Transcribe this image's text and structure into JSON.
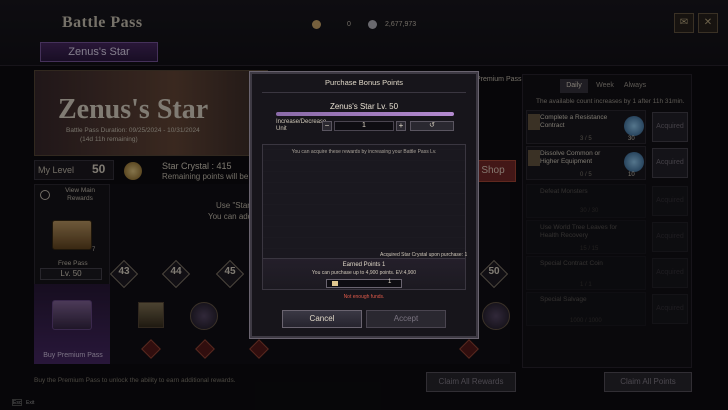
{
  "header": {
    "title": "Battle Pass",
    "tab": "Zenus's Star",
    "currency1": "0",
    "currency2": "2,677,973"
  },
  "banner": {
    "title": "Zenus's Star",
    "duration": "Battle Pass Duration: 09/25/2024 - 10/31/2024",
    "remaining": "(14d 11h remaining)",
    "premium_tag": "Premium Pass"
  },
  "level": {
    "label": "My Level",
    "value": "50"
  },
  "crystal": {
    "label": "Star Crystal : 415",
    "remaining": "Remaining points will be au"
  },
  "shop_label": "Shop",
  "left": {
    "view_main": "View Main Rewards",
    "free_pass": "Free Pass",
    "free_level": "Lv. 50",
    "buy_premium": "Buy Premium Pass",
    "chest_count": "7"
  },
  "track": {
    "use_label": "Use \"Star",
    "can_add": "You can add",
    "levels": [
      "43",
      "44",
      "45",
      "50"
    ]
  },
  "hint": "Buy the Premium Pass to unlock the ability to earn additional rewards.",
  "claim_all": "Claim All Rewards",
  "claim_all_points": "Claim All Points",
  "right": {
    "tabs": [
      "Daily",
      "Week",
      "Always"
    ],
    "note": "The available count increases by 1 after 11h 31min.",
    "missions": [
      {
        "name": "Complete a Resistance Contract",
        "count": "3 / 5",
        "orb": "30",
        "button": "Acquired"
      },
      {
        "name": "Dissolve Common or Higher Equipment",
        "count": "0 / 5",
        "orb": "10",
        "button": "Acquired"
      },
      {
        "name": "Defeat Monsters",
        "count": "30 / 30",
        "orb": "",
        "button": "Acquired"
      },
      {
        "name": "Use World Tree Leaves for Health Recovery",
        "count": "15 / 15",
        "orb": "",
        "button": "Acquired"
      },
      {
        "name": "Special Contract Coin",
        "count": "1 / 1",
        "orb": "",
        "button": "Acquired"
      },
      {
        "name": "Special Salvage",
        "count": "1000 / 1000",
        "orb": "",
        "button": "Acquired"
      }
    ]
  },
  "modal": {
    "title": "Purchase Bonus Points",
    "star_level": "Zenus's Star Lv. 50",
    "inc_label": "Increase/Decrease Unit",
    "quantity": "1",
    "reset": "↺",
    "reward_note": "You can acquire these rewards by increasing your Battle Pass Lv.",
    "acquired_label": "Acquired Star Crystal upon purchase: 1",
    "earned": "Earned Points  1",
    "purchase_note": "You can purchase up to 4,900 points. EV:4,900",
    "earned_value": "1",
    "warning": "Not enough funds.",
    "cancel": "Cancel",
    "accept": "Accept"
  },
  "esc": "Esc",
  "esc_label": "Exit"
}
